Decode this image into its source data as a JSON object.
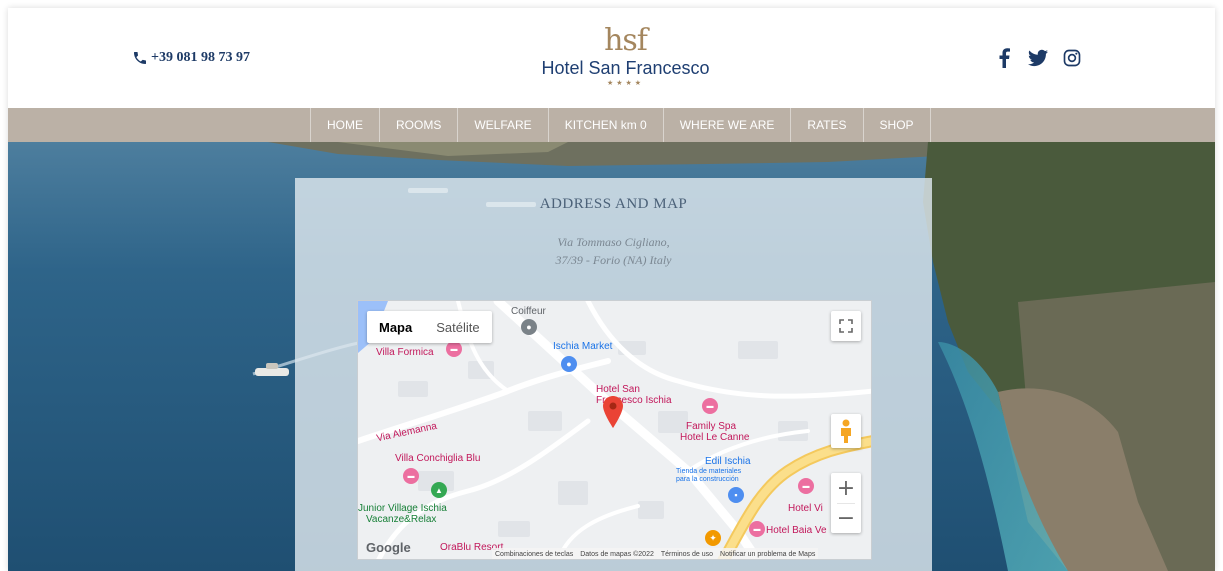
{
  "header": {
    "phone": "+39 081 98 73 97",
    "logo_mark": "hsf",
    "logo_name": "Hotel San Francesco",
    "logo_stars": "★★★★",
    "social": [
      "facebook-icon",
      "twitter-icon",
      "instagram-icon"
    ]
  },
  "nav": {
    "items": [
      {
        "label": "HOME"
      },
      {
        "label": "ROOMS"
      },
      {
        "label": "WELFARE"
      },
      {
        "label": "KITCHEN km 0"
      },
      {
        "label": "WHERE WE ARE"
      },
      {
        "label": "RATES"
      },
      {
        "label": "SHOP"
      }
    ]
  },
  "section": {
    "title": "ADDRESS AND MAP",
    "address_line1": "Via Tommaso Cigliano,",
    "address_line2": "37/39 - Forio (NA) Italy"
  },
  "map": {
    "type_buttons": {
      "map": "Mapa",
      "satellite": "Satélite"
    },
    "labels": {
      "coiffeur": "Coiffeur",
      "villa_formica": "Villa Formica",
      "ischia_market": "Ischia Market",
      "hotel_sf_1": "Hotel San",
      "hotel_sf_2": "Francesco Ischia",
      "via_alemanna": "Via Alemanna",
      "family_spa_1": "Family Spa",
      "family_spa_2": "Hotel Le Canne",
      "edil_ischia": "Edil Ischia",
      "tienda_1": "Tienda de materiales",
      "tienda_2": "para la construcción",
      "villa_conchiglia": "Villa Conchiglia Blu",
      "junior_village_1": "Junior Village Ischia",
      "junior_village_2": "Vacanze&Relax",
      "hotel_vi": "Hotel Vi",
      "hotel_baia": "Hotel Baia Ve",
      "orablu": "OraBlu Resort"
    },
    "google": "Google",
    "attribution": [
      "Combinaciones de teclas",
      "Datos de mapas ©2022",
      "Términos de uso",
      "Notificar un problema de Maps"
    ]
  },
  "colors": {
    "nav_bg": "#bbb1a6",
    "brand_blue": "#1f3f72",
    "brand_gold": "#a4865e",
    "panel_bg": "#dee8ee"
  }
}
